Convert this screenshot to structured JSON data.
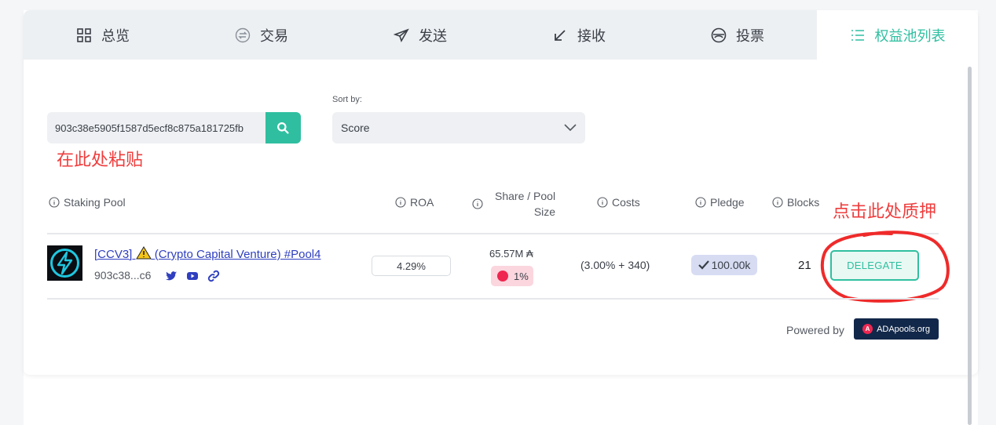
{
  "tabs": [
    {
      "label": "总览",
      "icon": "grid-icon"
    },
    {
      "label": "交易",
      "icon": "exchange-icon"
    },
    {
      "label": "发送",
      "icon": "send-icon"
    },
    {
      "label": "接收",
      "icon": "receive-arrow-icon"
    },
    {
      "label": "投票",
      "icon": "vote-icon"
    },
    {
      "label": "权益池列表",
      "icon": "list-icon",
      "active": true
    }
  ],
  "search": {
    "value": "903c38e5905f1587d5ecf8c875a181725fb"
  },
  "annotations": {
    "paste_here": "在此处粘贴",
    "click_to_delegate": "点击此处质押"
  },
  "sort": {
    "label": "Sort by:",
    "selected": "Score"
  },
  "table": {
    "headers": {
      "pool": "Staking Pool",
      "roa": "ROA",
      "share": "Share / Pool Size",
      "share_line1": "Share / Pool",
      "share_line2": "Size",
      "costs": "Costs",
      "pledge": "Pledge",
      "blocks": "Blocks"
    },
    "rows": [
      {
        "ticker": "[CCV3]",
        "name": "(Crypto Capital Venture) #Pool4",
        "id_short": "903c38...c6",
        "roa": "4.29%",
        "pool_size": "65.57M ₳",
        "share": "1%",
        "costs": "(3.00% + 340)",
        "pledge": "100.00k",
        "blocks": "21",
        "action": "DELEGATE"
      }
    ]
  },
  "footer": {
    "powered_by": "Powered by",
    "brand": "ADApools.org"
  },
  "colors": {
    "accent": "#2fbfa0",
    "annotation_red": "#ef3d3d",
    "link": "#2f3fbf",
    "share_pill": "#fbd6de",
    "pledge_pill": "#d7dcf3",
    "brand_navy": "#12284a"
  }
}
